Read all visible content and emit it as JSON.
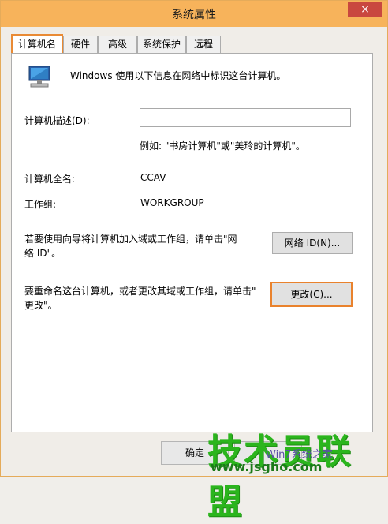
{
  "window": {
    "title": "系统属性",
    "close_glyph": "×"
  },
  "tabs": [
    {
      "label": "计算机名",
      "active": true
    },
    {
      "label": "硬件"
    },
    {
      "label": "高级"
    },
    {
      "label": "系统保护"
    },
    {
      "label": "远程"
    }
  ],
  "intro": "Windows 使用以下信息在网络中标识这台计算机。",
  "description": {
    "label": "计算机描述(D):",
    "value": "",
    "example": "例如: \"书房计算机\"或\"美玲的计算机\"。"
  },
  "full_name": {
    "label": "计算机全名:",
    "value": "CCAV"
  },
  "workgroup": {
    "label": "工作组:",
    "value": "WORKGROUP"
  },
  "network_id": {
    "text_line1": "若要使用向导将计算机加入域或工作组，请单击\"网",
    "text_line2": "络 ID\"。",
    "button": "网络 ID(N)..."
  },
  "rename": {
    "text_line1": "要重命名这台计算机，或者更改其域或工作组，请单击\"",
    "text_line2": "更改\"。",
    "button": "更改(C)..."
  },
  "footer": {
    "ok": "确定",
    "cancel": ""
  },
  "watermark": {
    "main": "技术员联盟",
    "url": "www.jsgho.com",
    "sub": "Win7系统之家"
  },
  "colors": {
    "accent_border": "#e98a34",
    "titlebar": "#f7b35b",
    "close": "#c9483f",
    "watermark": "#2bb51d"
  }
}
